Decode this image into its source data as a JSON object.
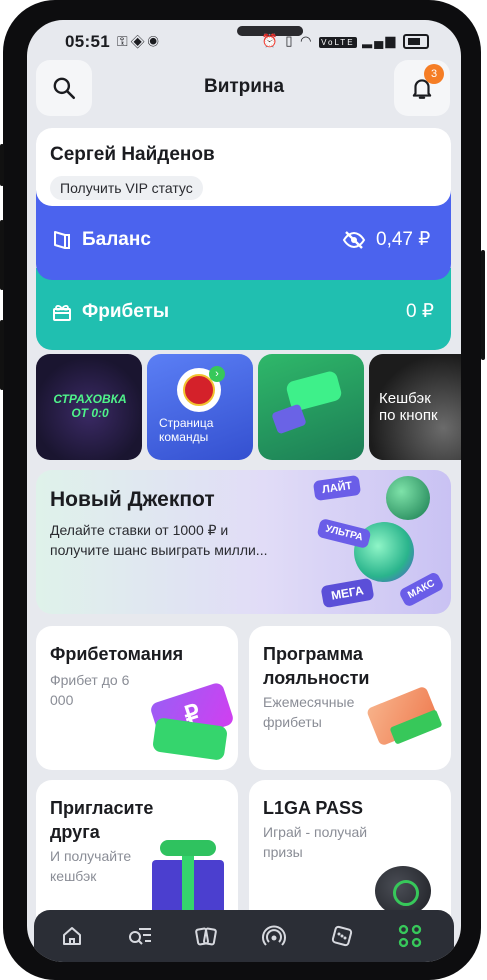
{
  "status_bar": {
    "time": "05:51",
    "left_icons": [
      "key-icon",
      "layers-icon",
      "game-icon"
    ],
    "right_icons": [
      "alarm-icon",
      "vibrate-icon",
      "wifi-icon",
      "volte-icon",
      "signal-icon",
      "battery-icon"
    ],
    "volte": "VoLTE"
  },
  "header": {
    "title": "Витрина",
    "notification_count": "3",
    "search_icon": "search-icon",
    "bell_icon": "bell-icon"
  },
  "profile": {
    "name": "Сергей Найденов",
    "vip_label": "Получить VIP статус",
    "balance_label": "Баланс",
    "balance_value": "0,47 ₽",
    "freebets_label": "Фрибеты",
    "freebets_value": "0 ₽"
  },
  "stories": [
    {
      "label": "СТРАХОВКА\nОТ 0:0"
    },
    {
      "label": "Страница\nкоманды"
    },
    {
      "label": ""
    },
    {
      "label": "Кешбэк\nпо кнопк"
    }
  ],
  "jackpot": {
    "title": "Новый Джекпот",
    "description": "Делайте ставки от 1000 ₽ и получите шанс выиграть милли...",
    "tags": [
      "ЛАЙТ",
      "УЛЬТРА",
      "МЕГА",
      "МАКС"
    ]
  },
  "cards": [
    {
      "title": "Фрибетомания",
      "subtitle": "Фрибет до 6 000"
    },
    {
      "title": "Программа лояльности",
      "subtitle": "Ежемесячные фрибеты"
    },
    {
      "title": "Пригласите друга",
      "subtitle": "И получайте кешбэк"
    },
    {
      "title": "L1GA PASS",
      "subtitle": "Играй - получай призы"
    }
  ],
  "tabbar": {
    "tabs": [
      "home-icon",
      "search-list-icon",
      "cards-icon",
      "live-icon",
      "dice-icon",
      "showcase-grid-icon"
    ],
    "active_color": "#37c85a"
  },
  "colors": {
    "balance_bg": "#4b63ee",
    "freebets_bg": "#20bfb0",
    "badge": "#f57d25"
  }
}
